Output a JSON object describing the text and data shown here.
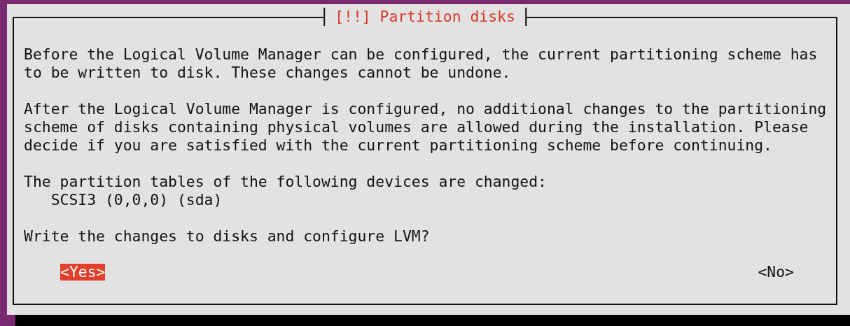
{
  "dialog": {
    "title": "[!!] Partition disks",
    "paragraphs": [
      "Before the Logical Volume Manager can be configured, the current partitioning scheme has\nto be written to disk. These changes cannot be undone.",
      "After the Logical Volume Manager is configured, no additional changes to the partitioning\nscheme of disks containing physical volumes are allowed during the installation. Please\ndecide if you are satisfied with the current partitioning scheme before continuing.",
      "The partition tables of the following devices are changed:"
    ],
    "devices": [
      "SCSI3 (0,0,0) (sda)"
    ],
    "question": "Write the changes to disks and configure LVM?",
    "buttons": [
      {
        "label": "<Yes>",
        "selected": true
      },
      {
        "label": "<No>",
        "selected": false
      }
    ]
  }
}
